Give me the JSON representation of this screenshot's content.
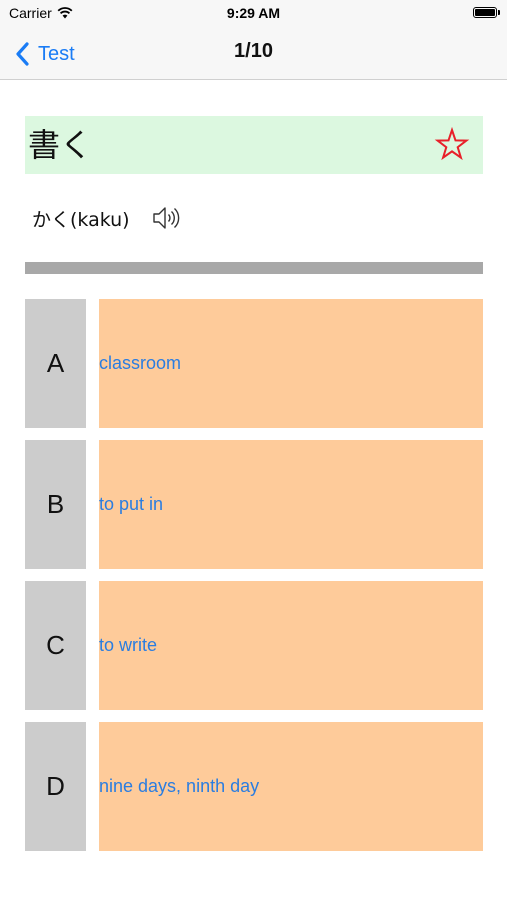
{
  "status_bar": {
    "carrier": "Carrier",
    "time": "9:29 AM"
  },
  "nav": {
    "back_label": "Test",
    "title": "1/10"
  },
  "question": {
    "word": "書く",
    "reading": "かく(kaku)"
  },
  "options": [
    {
      "letter": "A",
      "text": "classroom"
    },
    {
      "letter": "B",
      "text": "to put in"
    },
    {
      "letter": "C",
      "text": "to write"
    },
    {
      "letter": "D",
      "text": "nine days, ninth day"
    }
  ],
  "colors": {
    "accent": "#1a7cf5",
    "word_background": "#dcf8e0",
    "answer_background": "#fecb9a",
    "letter_background": "#cccccc",
    "divider": "#a8a8a8",
    "star": "#e8202a"
  },
  "icons": {
    "back": "chevron-left-icon",
    "favorite": "star-outline-icon",
    "audio": "speaker-icon",
    "wifi": "wifi-icon",
    "battery": "battery-icon"
  }
}
